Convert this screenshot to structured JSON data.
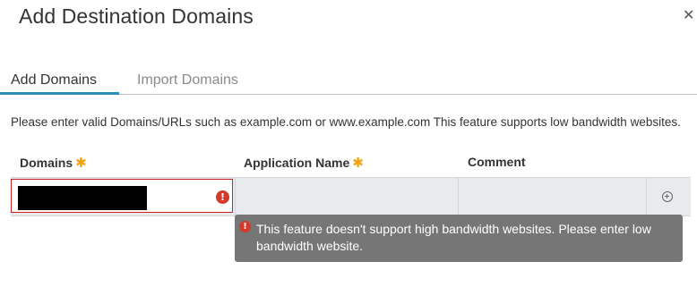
{
  "dialog": {
    "title": "Add Destination Domains",
    "close_icon": "close-icon"
  },
  "tabs": [
    {
      "label": "Add Domains",
      "active": true
    },
    {
      "label": "Import Domains",
      "active": false
    }
  ],
  "description": "Please enter valid Domains/URLs such as example.com or www.example.com This feature supports low bandwidth websites.",
  "table": {
    "columns": [
      {
        "label": "Domains",
        "required": true
      },
      {
        "label": "Application Name",
        "required": true
      },
      {
        "label": "Comment",
        "required": false
      }
    ],
    "required_marker": "✱",
    "row": {
      "domain_value": "",
      "application_value": "",
      "comment_value": "",
      "error_icon": "exclamation-circle-icon",
      "add_icon": "plus-circle-icon"
    }
  },
  "tooltip": {
    "message": "This feature doesn't support high bandwidth websites. Please enter low bandwidth website."
  },
  "colors": {
    "accent": "#2a8dbe",
    "error": "#d43a2a",
    "required": "#f0a30a",
    "tooltip_bg": "#767676",
    "row_bg": "#e8ebee"
  }
}
